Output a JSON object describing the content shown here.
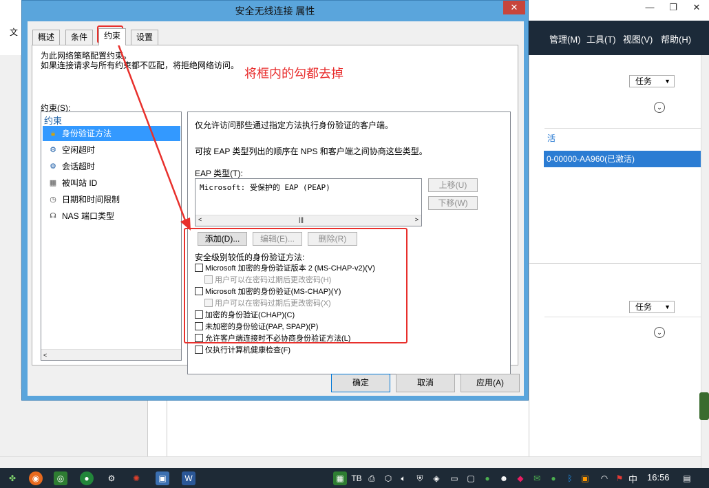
{
  "background": {
    "menu": [
      "管理(M)",
      "工具(T)",
      "视图(V)",
      "帮助(H)"
    ],
    "left_menu_fragment": "文",
    "task_button_1": "任务",
    "task_button_2": "任务",
    "item_fragment": "活",
    "selected_item": "0-00000-AA960(已激活)"
  },
  "dialog": {
    "title": "安全无线连接 属性",
    "close_glyph": "✕",
    "tabs": [
      "概述",
      "条件",
      "约束",
      "设置"
    ],
    "description_line1": "为此网络策略配置约束。",
    "description_line2": "如果连接请求与所有约束都不匹配，将拒绝网络访问。",
    "constraints_label": "约束(S):",
    "tree": {
      "header": "约束",
      "items": [
        {
          "label": "身份验证方法",
          "icon": "lock-icon"
        },
        {
          "label": "空闲超时",
          "icon": "idle-timeout-icon"
        },
        {
          "label": "会话超时",
          "icon": "session-timeout-icon"
        },
        {
          "label": "被叫站 ID",
          "icon": "called-station-icon"
        },
        {
          "label": "日期和时间限制",
          "icon": "clock-icon"
        },
        {
          "label": "NAS 端口类型",
          "icon": "nas-port-icon"
        }
      ]
    },
    "pane": {
      "intro": "仅允许访问那些通过指定方法执行身份验证的客户端。",
      "eap_order_note": "可按 EAP 类型列出的顺序在 NPS 和客户端之间协商这些类型。",
      "eap_label": "EAP 类型(T):",
      "eap_items": [
        "Microsoft: 受保护的 EAP (PEAP)"
      ],
      "move_up": "上移(U)",
      "move_down": "下移(W)",
      "add": "添加(D)...",
      "edit": "编辑(E)...",
      "remove": "删除(R)",
      "less_secure_label": "安全级别较低的身份验证方法:",
      "checkboxes": [
        {
          "label": "Microsoft 加密的身份验证版本 2 (MS-CHAP-v2)(V)",
          "checked": false,
          "disabled": false
        },
        {
          "label": "用户可以在密码过期后更改密码(H)",
          "checked": false,
          "disabled": true
        },
        {
          "label": "Microsoft 加密的身份验证(MS-CHAP)(Y)",
          "checked": false,
          "disabled": false
        },
        {
          "label": "用户可以在密码过期后更改密码(X)",
          "checked": false,
          "disabled": true
        },
        {
          "label": "加密的身份验证(CHAP)(C)",
          "checked": false,
          "disabled": false
        },
        {
          "label": "未加密的身份验证(PAP, SPAP)(P)",
          "checked": false,
          "disabled": false
        },
        {
          "label": "允许客户端连接时不必协商身份验证方法(L)",
          "checked": false,
          "disabled": false
        },
        {
          "label": "仅执行计算机健康检查(F)",
          "checked": false,
          "disabled": false
        }
      ]
    },
    "buttons": {
      "ok": "确定",
      "cancel": "取消",
      "apply": "应用(A)"
    }
  },
  "annotation": {
    "text": "将框内的勾都去掉",
    "color": "#e82c2c"
  },
  "taskbar": {
    "ime": "中",
    "clock": "16:56"
  }
}
